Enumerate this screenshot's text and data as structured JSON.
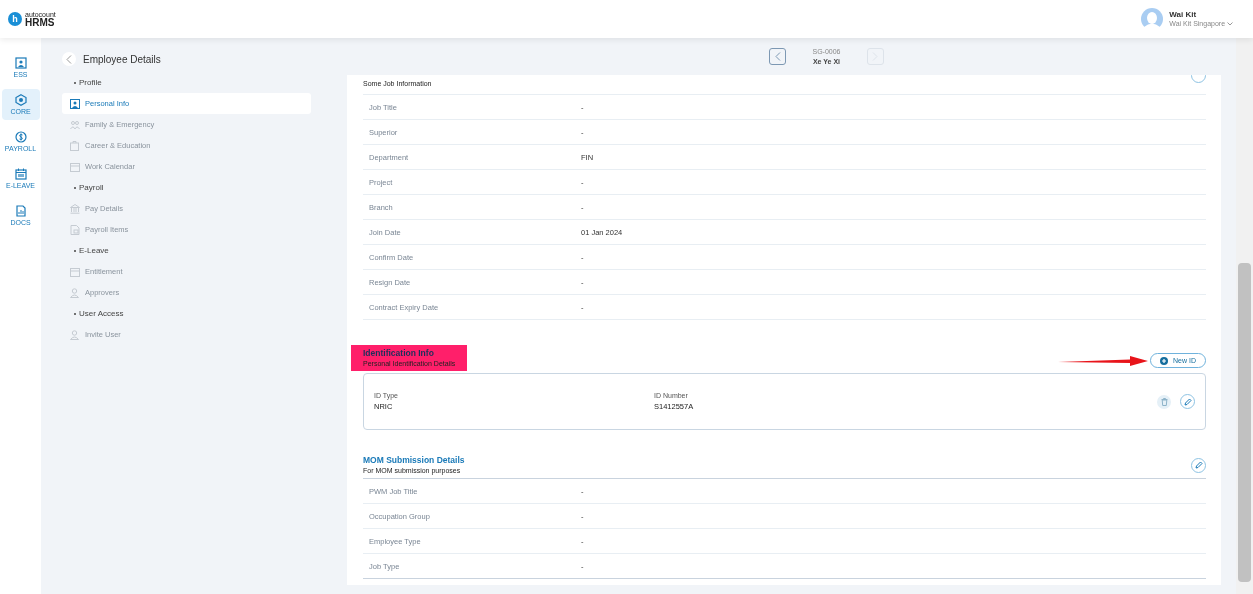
{
  "brand": {
    "small": "autocount",
    "big": "HRMS",
    "mark": "h"
  },
  "user": {
    "name": "Wai Kit",
    "company": "Wai Kit Singapore"
  },
  "rail": [
    {
      "label": "ESS",
      "selected": false
    },
    {
      "label": "CORE",
      "selected": true
    },
    {
      "label": "PAYROLL",
      "selected": false
    },
    {
      "label": "E-LEAVE",
      "selected": false
    },
    {
      "label": "DOCS",
      "selected": false
    }
  ],
  "page_title": "Employee Details",
  "navigator": {
    "code": "SG-0006",
    "name": "Xe Ye Xi",
    "prev_disabled": false,
    "next_disabled": true
  },
  "subnav": [
    {
      "title": "Profile",
      "items": [
        {
          "label": "Personal Info",
          "selected": true
        },
        {
          "label": "Family & Emergency",
          "selected": false
        },
        {
          "label": "Career & Education",
          "selected": false
        },
        {
          "label": "Work Calendar",
          "selected": false
        }
      ]
    },
    {
      "title": "Payroll",
      "items": [
        {
          "label": "Pay Details",
          "selected": false
        },
        {
          "label": "Payroll Items",
          "selected": false
        }
      ]
    },
    {
      "title": "E-Leave",
      "items": [
        {
          "label": "Entitlement",
          "selected": false
        },
        {
          "label": "Approvers",
          "selected": false
        }
      ]
    },
    {
      "title": "User Access",
      "items": [
        {
          "label": "Invite User",
          "selected": false
        }
      ]
    }
  ],
  "job": {
    "subtitle": "Some Job Information",
    "rows": [
      {
        "label": "Job Title",
        "value": "-"
      },
      {
        "label": "Superior",
        "value": "-"
      },
      {
        "label": "Department",
        "value": "FIN"
      },
      {
        "label": "Project",
        "value": "-"
      },
      {
        "label": "Branch",
        "value": "-"
      },
      {
        "label": "Join Date",
        "value": "01 Jan 2024"
      },
      {
        "label": "Confirm Date",
        "value": "-"
      },
      {
        "label": "Resign Date",
        "value": "-"
      },
      {
        "label": "Contract Expiry Date",
        "value": "-"
      }
    ]
  },
  "identification": {
    "title": "Identification Info",
    "subtitle": "Personal Identification Details",
    "highlighted": true,
    "new_button": "New ID",
    "arrow_pointing": true,
    "records": [
      {
        "type_label": "ID Type",
        "type": "NRIC",
        "number_label": "ID Number",
        "number": "S1412557A"
      }
    ]
  },
  "mom": {
    "title": "MOM Submission Details",
    "subtitle": "For MOM submission purposes",
    "rows": [
      {
        "label": "PWM Job Title",
        "value": "-"
      },
      {
        "label": "Occupation Group",
        "value": "-"
      },
      {
        "label": "Employee Type",
        "value": "-"
      },
      {
        "label": "Job Type",
        "value": "-"
      }
    ]
  }
}
